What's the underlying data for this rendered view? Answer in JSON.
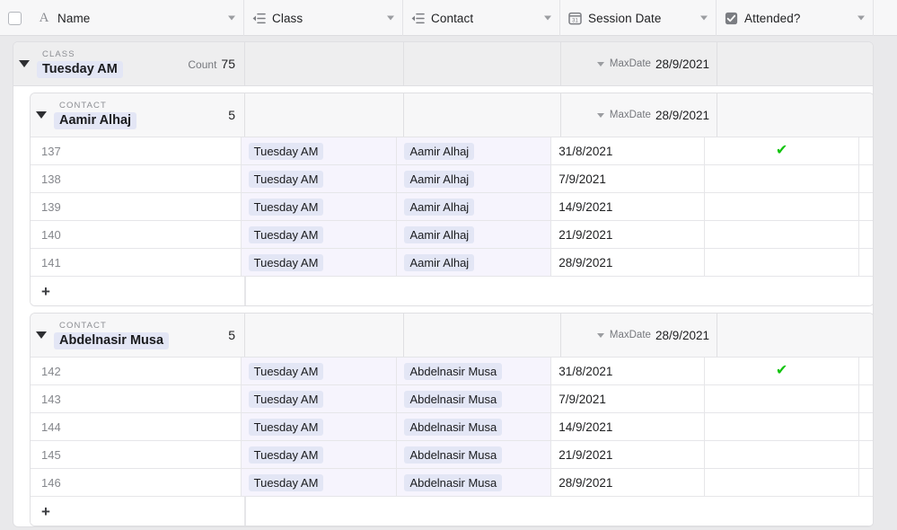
{
  "header": {
    "select_all_checkbox": "select-all",
    "columns": [
      {
        "id": "name",
        "label": "Name",
        "icon": "text-field-icon",
        "icon_glyph": "A"
      },
      {
        "id": "class",
        "label": "Class",
        "icon": "linked-record-icon"
      },
      {
        "id": "contact",
        "label": "Contact",
        "icon": "linked-record-icon"
      },
      {
        "id": "date",
        "label": "Session Date",
        "icon": "calendar-icon",
        "icon_glyph": "31"
      },
      {
        "id": "attended",
        "label": "Attended?",
        "icon": "checkbox-field-icon"
      }
    ]
  },
  "colors": {
    "chip_bg": "#e3e6f5",
    "cell_tint": "#f6f4fd",
    "check_green": "#13c40f",
    "canvas": "#e9e9eb",
    "class_group_header_bg": "#eeeeef",
    "contact_group_header_bg": "#f7f7f8"
  },
  "class_group": {
    "field_label": "CLASS",
    "value": "Tuesday AM",
    "count_label": "Count",
    "count_value": "75",
    "summary": {
      "label": "MaxDate",
      "value": "28/9/2021"
    },
    "contact_groups": [
      {
        "field_label": "CONTACT",
        "value": "Aamir Alhaj",
        "count_value": "5",
        "summary": {
          "label": "MaxDate",
          "value": "28/9/2021"
        },
        "rows": [
          {
            "name": "137",
            "class": "Tuesday AM",
            "contact": "Aamir Alhaj",
            "date": "31/8/2021",
            "attended": true
          },
          {
            "name": "138",
            "class": "Tuesday AM",
            "contact": "Aamir Alhaj",
            "date": "7/9/2021",
            "attended": false
          },
          {
            "name": "139",
            "class": "Tuesday AM",
            "contact": "Aamir Alhaj",
            "date": "14/9/2021",
            "attended": false
          },
          {
            "name": "140",
            "class": "Tuesday AM",
            "contact": "Aamir Alhaj",
            "date": "21/9/2021",
            "attended": false
          },
          {
            "name": "141",
            "class": "Tuesday AM",
            "contact": "Aamir Alhaj",
            "date": "28/9/2021",
            "attended": false
          }
        ],
        "add_row_label": "+"
      },
      {
        "field_label": "CONTACT",
        "value": "Abdelnasir Musa",
        "count_value": "5",
        "summary": {
          "label": "MaxDate",
          "value": "28/9/2021"
        },
        "rows": [
          {
            "name": "142",
            "class": "Tuesday AM",
            "contact": "Abdelnasir Musa",
            "date": "31/8/2021",
            "attended": true
          },
          {
            "name": "143",
            "class": "Tuesday AM",
            "contact": "Abdelnasir Musa",
            "date": "7/9/2021",
            "attended": false
          },
          {
            "name": "144",
            "class": "Tuesday AM",
            "contact": "Abdelnasir Musa",
            "date": "14/9/2021",
            "attended": false
          },
          {
            "name": "145",
            "class": "Tuesday AM",
            "contact": "Abdelnasir Musa",
            "date": "21/9/2021",
            "attended": false
          },
          {
            "name": "146",
            "class": "Tuesday AM",
            "contact": "Abdelnasir Musa",
            "date": "28/9/2021",
            "attended": false
          }
        ],
        "add_row_label": "+"
      }
    ]
  }
}
